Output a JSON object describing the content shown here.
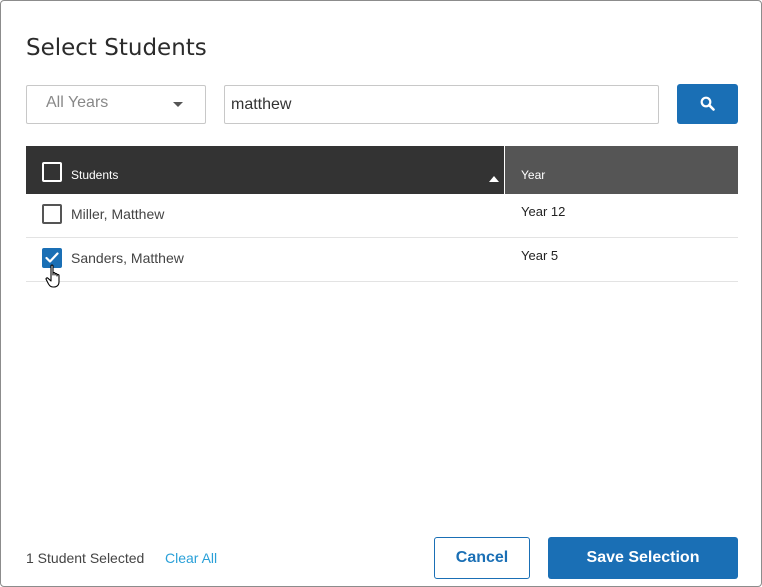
{
  "dialog": {
    "title": "Select Students"
  },
  "filters": {
    "year_select": {
      "selected": "All Years"
    },
    "search": {
      "value": "matthew",
      "placeholder": ""
    },
    "search_button_icon": "search-icon"
  },
  "table": {
    "columns": [
      "Students",
      "Year"
    ],
    "sort": {
      "column": "Students",
      "direction": "ascending"
    },
    "rows": [
      {
        "name": "Miller, Matthew",
        "year": "Year 12",
        "checked": false
      },
      {
        "name": "Sanders, Matthew",
        "year": "Year 5",
        "checked": true
      }
    ]
  },
  "footer": {
    "selected_count": "1 Student Selected",
    "clear_all": "Clear All",
    "cancel": "Cancel",
    "save": "Save Selection"
  },
  "colors": {
    "primary": "#1a6fb5",
    "link": "#2aa0d8",
    "header_dark": "#333333",
    "header_mid": "#555555"
  }
}
